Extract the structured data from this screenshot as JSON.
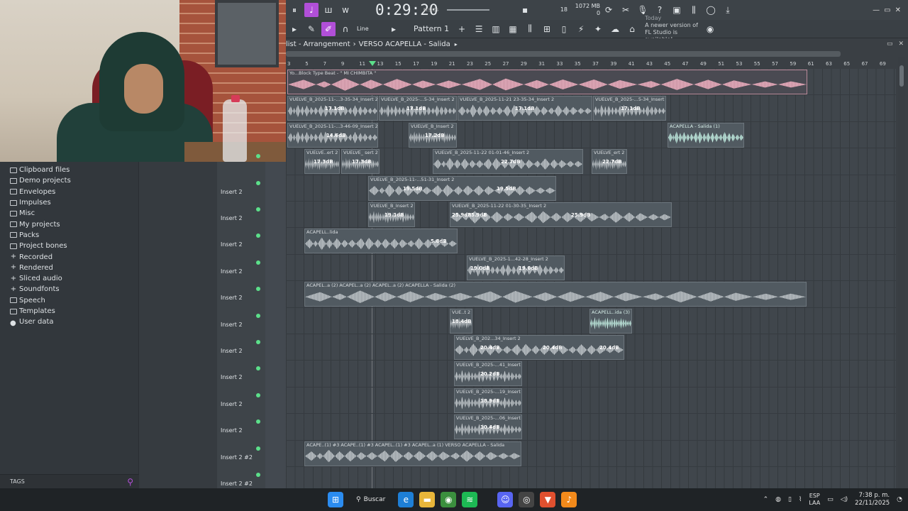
{
  "toolbar": {
    "time": "0:29:20",
    "time_unit": "M:S:CS",
    "cpu_value": "18",
    "memory": "1072 MB",
    "poly": "0",
    "pattern": "Pattern 1",
    "snap": "Line",
    "update_notice_today": "Today",
    "update_notice": "A newer version of FL Studio is available!"
  },
  "breadcrumb": {
    "root": "list - Arrangement",
    "sep": "›",
    "current": "VERSO ACAPELLA - Salida",
    "arrow": "▸"
  },
  "ruler": {
    "bars": [
      "3",
      "5",
      "7",
      "9",
      "11",
      "13",
      "15",
      "17",
      "19",
      "21",
      "23",
      "25",
      "27",
      "29",
      "31",
      "33",
      "35",
      "37",
      "39",
      "41",
      "43",
      "45",
      "47",
      "49",
      "51",
      "53",
      "55",
      "57",
      "59",
      "61",
      "63",
      "65",
      "67",
      "69"
    ]
  },
  "browser": {
    "items": [
      {
        "label": "Clipboard files",
        "icon": "folder-icon"
      },
      {
        "label": "Demo projects",
        "icon": "folder-icon"
      },
      {
        "label": "Envelopes",
        "icon": "folder-icon"
      },
      {
        "label": "Impulses",
        "icon": "folder-icon"
      },
      {
        "label": "Misc",
        "icon": "folder-icon"
      },
      {
        "label": "My projects",
        "icon": "folder-icon"
      },
      {
        "label": "Packs",
        "icon": "folder-icon"
      },
      {
        "label": "Project bones",
        "icon": "folder-icon"
      },
      {
        "label": "Recorded",
        "icon": "plus-icon"
      },
      {
        "label": "Rendered",
        "icon": "plus-icon"
      },
      {
        "label": "Sliced audio",
        "icon": "plus-icon"
      },
      {
        "label": "Soundfonts",
        "icon": "plus-icon"
      },
      {
        "label": "Speech",
        "icon": "folder-icon"
      },
      {
        "label": "Templates",
        "icon": "folder-icon"
      },
      {
        "label": "User data",
        "icon": "user-icon"
      }
    ],
    "tags_label": "TAGS"
  },
  "tracks": [
    {
      "label": ""
    },
    {
      "label": ""
    },
    {
      "label": ""
    },
    {
      "label": ""
    },
    {
      "label": "Insert 2"
    },
    {
      "label": "Insert 2"
    },
    {
      "label": "Insert 2"
    },
    {
      "label": "Insert 2"
    },
    {
      "label": "Insert 2"
    },
    {
      "label": "Insert 2"
    },
    {
      "label": "Insert 2"
    },
    {
      "label": "Insert 2"
    },
    {
      "label": "Insert 2"
    },
    {
      "label": "Insert 2"
    },
    {
      "label": "Insert 2 #2"
    },
    {
      "label": "Insert 2 #2"
    }
  ],
  "clips": {
    "beat": "Yo...Block Type Beat - \" MI CHIMBITA \"",
    "c1a": "VUELVE_B_2025-11-...3-35-34_Insert 2",
    "c1b": "VUELVE_B_2025-...5-34_Insert 2",
    "c1c": "VUELVE_B_2025-11-21 23-35-34_Insert 2",
    "c1d": "VUELVE_B_2025-...5-34_Insert 2",
    "g17": "17.1dB",
    "c2a": "VUELVE_B_2025-11-...3-46-09_Insert 2",
    "c2b": "VUELVE_B_Insert 2",
    "c2c": "ACAPELLA - Salida (1)",
    "g146": "14.6dB",
    "g172": "17.2dB",
    "c3a": "VUELVE..ert 2",
    "c3b": "VUELVE_ sert 2",
    "c3c": "VUELVE_B_2025-11-22 01-01-46_Insert 2",
    "c3d": "VUELVE_ert 2",
    "g173": "17.3dB",
    "g227": "22.7dB",
    "c4a": "VUELVE_B_2025-11-...51-31_Insert 2",
    "c4b": "VUELVE_B_2025-11-21 23-51-31_Insert 2",
    "g195": "19.5dB",
    "c5a": "VUELVE_B_Insert 2",
    "c5b": "VUELVE_B_2025-11-22 01-30-35_Insert 2",
    "g191": "19.1dB",
    "g259": "25.9dB",
    "c6a": "ACAPELL..lida",
    "c6b": "ACAPELLA - Salida",
    "c6c": "ACAPELL..alida",
    "g58": "5.8dB",
    "c7a": "VU..2",
    "c7b": "VUELVE_B_2025-1...42-28_Insert 2",
    "g190": "19.0dB",
    "c8": "ACAPEL..a (2)  ACAPEL..a (2)  ACAPEL..a (2)  ACAPELLA - Salida (2)",
    "c9a": "VUE..t 2",
    "c9b": "ACAPELL..ida (3)",
    "g184": "18.4dB",
    "c10a": "VUELVE_B_202...34_Insert 2",
    "c10b": "VUELVE_B_2...4_Insert 2",
    "c10c": "VUELVE..ert 2",
    "g204": "20.4dB",
    "c11": "VUELVE_B_2025-...41_Insert 2",
    "g202": "20.2dB",
    "c12": "VUELVE_B_2025-...19_Insert 2",
    "g189": "18.9dB",
    "c13": "VUELVE_B_2025-...06_Insert 2",
    "g104": "10.4dB",
    "c14": "ACAPE..(1) #3  ACAPE..(1) #3  ACAPEL..(1) #3  ACAPEL..a (1)  VERSO ACAPELLA - Salida"
  },
  "taskbar": {
    "search": "Buscar",
    "lang1": "ESP",
    "lang2": "LAA",
    "time": "7:38 p. m.",
    "date": "22/11/2025"
  }
}
